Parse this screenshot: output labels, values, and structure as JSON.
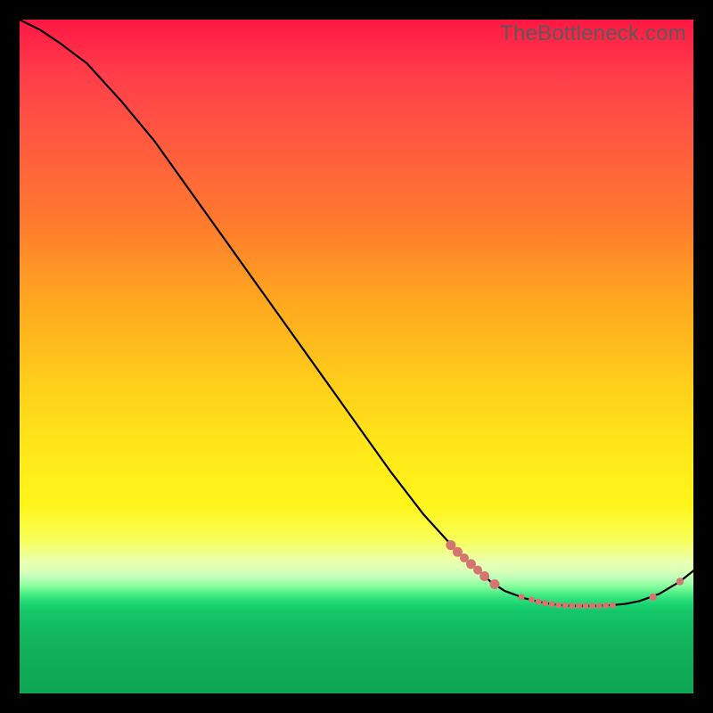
{
  "watermark": "TheBottleneck.com",
  "colors": {
    "marker": "#d4766f",
    "curve": "#000000"
  },
  "chart_data": {
    "type": "line",
    "title": "",
    "xlabel": "",
    "ylabel": "",
    "xlim": [
      0,
      100
    ],
    "ylim": [
      0,
      100
    ],
    "grid": false,
    "legend": false,
    "series": [
      {
        "name": "bottleneck-curve",
        "x": [
          0,
          3,
          6,
          10,
          15,
          20,
          25,
          30,
          35,
          40,
          45,
          50,
          55,
          60,
          65,
          70,
          72,
          75,
          78,
          80,
          82,
          85,
          88,
          90,
          92,
          95,
          98,
          100
        ],
        "y": [
          100,
          98.5,
          96.5,
          93.5,
          88,
          82,
          75,
          68,
          61,
          54,
          47,
          40,
          33,
          26.5,
          21,
          16.5,
          15.2,
          14.1,
          13.4,
          13.1,
          13.0,
          13.0,
          13.1,
          13.3,
          13.7,
          14.8,
          16.6,
          18.2
        ]
      }
    ],
    "markers": [
      {
        "x": 64,
        "y": 22.0,
        "r": 5.5
      },
      {
        "x": 65,
        "y": 21.0,
        "r": 5.5
      },
      {
        "x": 66,
        "y": 20.1,
        "r": 5.0
      },
      {
        "x": 67,
        "y": 19.2,
        "r": 5.5
      },
      {
        "x": 68,
        "y": 18.3,
        "r": 5.0
      },
      {
        "x": 69,
        "y": 17.4,
        "r": 5.5
      },
      {
        "x": 70.5,
        "y": 16.2,
        "r": 5.5
      },
      {
        "x": 74.5,
        "y": 14.3,
        "r": 3.5
      },
      {
        "x": 76,
        "y": 13.9,
        "r": 3.5
      },
      {
        "x": 77,
        "y": 13.6,
        "r": 3.5
      },
      {
        "x": 78,
        "y": 13.4,
        "r": 3.5
      },
      {
        "x": 79,
        "y": 13.25,
        "r": 3.5
      },
      {
        "x": 80,
        "y": 13.1,
        "r": 3.5
      },
      {
        "x": 81,
        "y": 13.05,
        "r": 3.5
      },
      {
        "x": 82,
        "y": 13.0,
        "r": 3.5
      },
      {
        "x": 83,
        "y": 13.0,
        "r": 3.5
      },
      {
        "x": 84,
        "y": 13.0,
        "r": 3.5
      },
      {
        "x": 85,
        "y": 13.0,
        "r": 3.5
      },
      {
        "x": 86,
        "y": 13.0,
        "r": 3.5
      },
      {
        "x": 87,
        "y": 13.05,
        "r": 3.5
      },
      {
        "x": 88,
        "y": 13.1,
        "r": 3.5
      },
      {
        "x": 94,
        "y": 14.3,
        "r": 4.2
      },
      {
        "x": 98,
        "y": 16.6,
        "r": 4.2
      }
    ]
  }
}
